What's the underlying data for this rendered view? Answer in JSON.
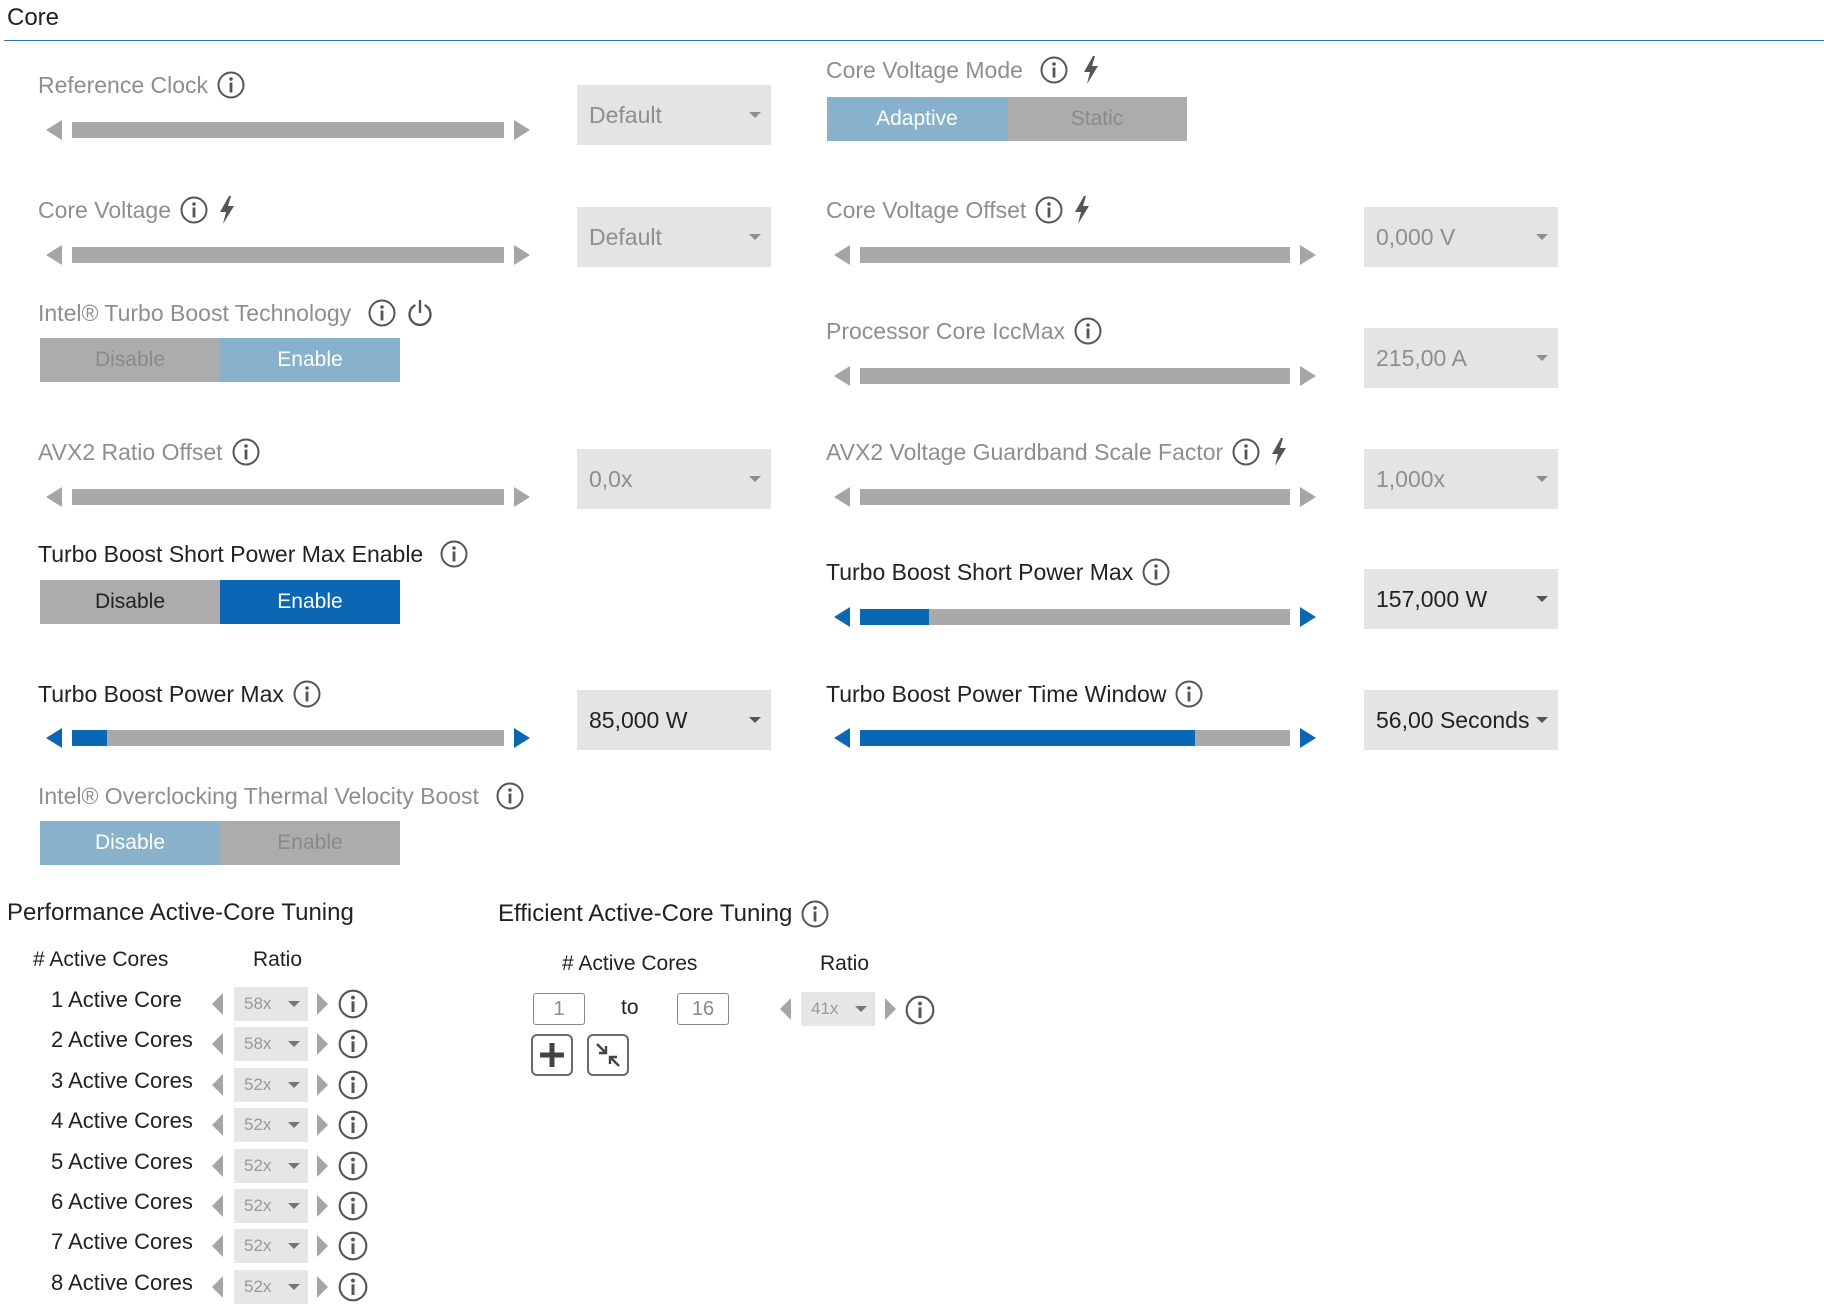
{
  "header": {
    "title": "Core"
  },
  "left": {
    "reference_clock": {
      "label": "Reference Clock",
      "value": "Default"
    },
    "core_voltage": {
      "label": "Core Voltage",
      "value": "Default"
    },
    "turbo_boost_tech": {
      "label": "Intel® Turbo Boost Technology",
      "options": [
        "Disable",
        "Enable"
      ],
      "selected": "Enable"
    },
    "avx2_ratio_offset": {
      "label": "AVX2 Ratio Offset",
      "value": "0,0x"
    },
    "short_power_max_enable": {
      "label": "Turbo Boost Short Power Max Enable",
      "options": [
        "Disable",
        "Enable"
      ],
      "selected": "Enable"
    },
    "power_max": {
      "label": "Turbo Boost Power Max",
      "value": "85,000 W",
      "slider_fraction": 0.08
    },
    "tvb": {
      "label": "Intel® Overclocking Thermal Velocity Boost",
      "options": [
        "Disable",
        "Enable"
      ],
      "selected": "Disable"
    }
  },
  "right": {
    "core_voltage_mode": {
      "label": "Core Voltage Mode",
      "options": [
        "Adaptive",
        "Static"
      ],
      "selected": "Adaptive"
    },
    "core_voltage_offset": {
      "label": "Core Voltage Offset",
      "value": "0,000 V"
    },
    "icc_max": {
      "label": "Processor Core IccMax",
      "value": "215,00 A"
    },
    "avx2_guardband": {
      "label": "AVX2 Voltage Guardband Scale Factor",
      "value": "1,000x"
    },
    "short_power_max": {
      "label": "Turbo Boost Short Power Max",
      "value": "157,000 W",
      "slider_fraction": 0.16
    },
    "power_time_window": {
      "label": "Turbo Boost Power Time Window",
      "value": "56,00 Seconds",
      "slider_fraction": 0.78
    }
  },
  "perf_tuning": {
    "title": "Performance Active-Core Tuning",
    "col_active": "# Active Cores",
    "col_ratio": "Ratio",
    "rows": [
      {
        "label": "1 Active Core",
        "ratio": "58x"
      },
      {
        "label": "2 Active Cores",
        "ratio": "58x"
      },
      {
        "label": "3 Active Cores",
        "ratio": "52x"
      },
      {
        "label": "4 Active Cores",
        "ratio": "52x"
      },
      {
        "label": "5 Active Cores",
        "ratio": "52x"
      },
      {
        "label": "6 Active Cores",
        "ratio": "52x"
      },
      {
        "label": "7 Active Cores",
        "ratio": "52x"
      },
      {
        "label": "8 Active Cores",
        "ratio": "52x"
      }
    ]
  },
  "eff_tuning": {
    "title": "Efficient Active-Core Tuning",
    "col_active": "# Active Cores",
    "col_ratio": "Ratio",
    "from": "1",
    "to_label": "to",
    "to": "16",
    "ratio": "41x"
  }
}
